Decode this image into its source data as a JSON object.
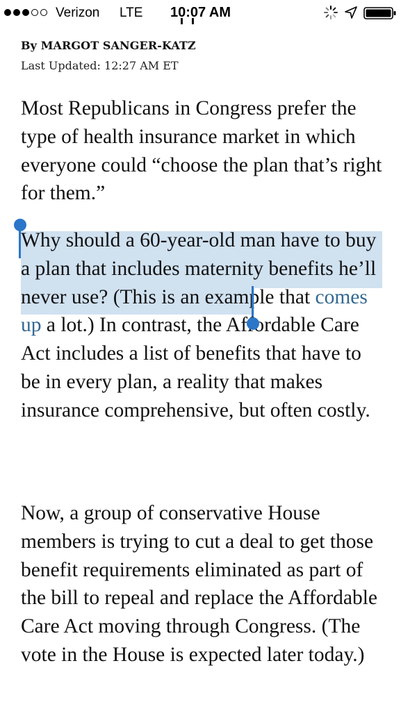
{
  "status_bar": {
    "carrier": "Verizon",
    "network": "LTE",
    "time": "10:07 AM",
    "icons": [
      "signal-dots",
      "activity-icon",
      "location-arrow-icon",
      "battery-icon"
    ]
  },
  "article": {
    "byline": "By MARGOT SANGER-KATZ",
    "updated": "Last Updated: 12:27 AM ET",
    "p1": "Most Republicans in Congress prefer the type of health insurance market in which everyone could “choose the plan that’s right for them.”",
    "p2_selected": "Why should a 60-year-old man have to buy a plan that includes maternity benefits he’ll never use?",
    "p2_before_link": " (This is an example that ",
    "p2_link": "comes up",
    "p2_after_link": " a lot.) In contrast, the Affordable Care Act includes a list of benefits that have to be in every plan, a reality that makes insurance comprehensive, but often costly.",
    "p3": "Now, a group of conservative House members is trying to cut a deal to get those benefit requirements eliminated as part of the bill to repeal and replace the Affordable Care Act moving through Congress. (The vote in the House is expected later today.)"
  },
  "colors": {
    "link": "#326891",
    "selection": "#aac8e4",
    "handle": "#2b76c8"
  }
}
